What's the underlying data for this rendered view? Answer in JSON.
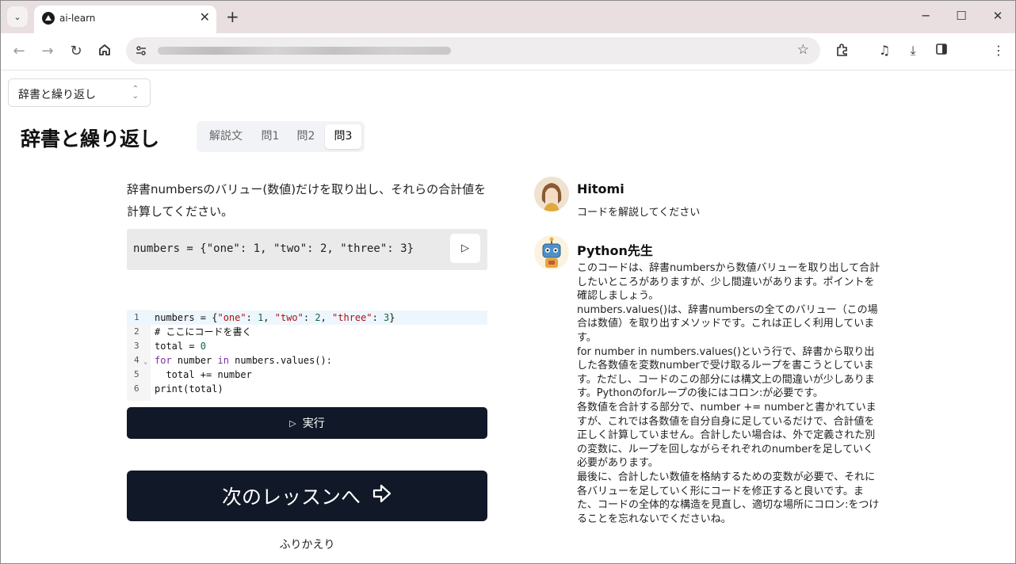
{
  "browser": {
    "tab_title": "ai-learn",
    "tab_close": "✕",
    "new_tab": "+",
    "window_controls": {
      "minimize": "─",
      "maximize": "☐",
      "close": "✕"
    }
  },
  "lesson_select": {
    "value": "辞書と繰り返し"
  },
  "page_title": "辞書と繰り返し",
  "tabs": [
    {
      "label": "解説文",
      "active": false
    },
    {
      "label": "問1",
      "active": false
    },
    {
      "label": "問2",
      "active": false
    },
    {
      "label": "問3",
      "active": true
    }
  ],
  "question": {
    "text": "辞書numbersのバリュー(数値)だけを取り出し、それらの合計値を計算してください。",
    "sample_code": "numbers = {\"one\": 1, \"two\": 2, \"three\": 3}"
  },
  "editor": {
    "lines": [
      {
        "n": "1",
        "code": "numbers = {\"one\": 1, \"two\": 2, \"three\": 3}"
      },
      {
        "n": "2",
        "code": "# ここにコードを書く"
      },
      {
        "n": "3",
        "code": "total = 0"
      },
      {
        "n": "4",
        "code": "for number in numbers.values():"
      },
      {
        "n": "5",
        "code": "  total += number"
      },
      {
        "n": "6",
        "code": "print(total)"
      }
    ]
  },
  "run_button": {
    "label": "実行"
  },
  "next_button": {
    "label": "次のレッスンへ"
  },
  "review_link": "ふりかえり",
  "chat": {
    "user": {
      "name": "Hitomi",
      "message": "コードを解説してください"
    },
    "teacher": {
      "name": "Python先生",
      "paragraphs": [
        "このコードは、辞書numbersから数値バリューを取り出して合計したいところがありますが、少し間違いがあります。ポイントを確認しましょう。",
        "numbers.values()は、辞書numbersの全てのバリュー（この場合は数値）を取り出すメソッドです。これは正しく利用しています。",
        "for number in numbers.values()という行で、辞書から取り出した各数値を変数numberで受け取るループを書こうとしています。ただし、コードのこの部分には構文上の間違いが少しあります。Pythonのforループの後にはコロン:が必要です。",
        "各数値を合計する部分で、number += numberと書かれていますが、これでは各数値を自分自身に足しているだけで、合計値を正しく計算していません。合計したい場合は、外で定義された別の変数に、ループを回しながらそれぞれのnumberを足していく必要があります。",
        "最後に、合計したい数値を格納するための変数が必要で、それに各バリューを足していく形にコードを修正すると良いです。また、コードの全体的な構造を見直し、適切な場所にコロン:をつけることを忘れないでくださいね。"
      ]
    }
  }
}
